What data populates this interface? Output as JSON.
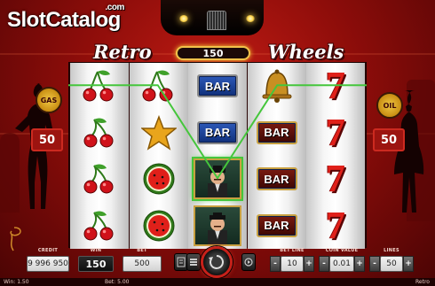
{
  "watermark": {
    "brand": "SlotCatalog",
    "suffix": ".com"
  },
  "game": {
    "title_left": "Retro",
    "title_right": "Wheels",
    "win_meter": "150",
    "side_left": {
      "badge": "GAS",
      "value": "50"
    },
    "side_right": {
      "badge": "OIL",
      "value": "50"
    }
  },
  "reels": [
    [
      "cherries",
      "cherry",
      "cherry",
      "cherry"
    ],
    [
      "cherries",
      "star",
      "watermelon",
      "watermelon"
    ],
    [
      "bar",
      "bar",
      "character",
      "character"
    ],
    [
      "bell",
      "bar-red",
      "bar-red",
      "bar-red"
    ],
    [
      "seven",
      "seven",
      "seven",
      "seven"
    ]
  ],
  "symbol_labels": {
    "bar": "BAR"
  },
  "winning_line": {
    "color": "#45c63c",
    "rows": [
      0,
      0,
      2,
      0,
      0
    ]
  },
  "panel": {
    "credit": {
      "label": "CREDIT",
      "value": "9 996 950"
    },
    "win": {
      "label": "WIN",
      "value": "150"
    },
    "bet": {
      "label": "BET",
      "value": "500"
    },
    "bet_line": {
      "label": "BET LINE",
      "value": "10"
    },
    "coin_value": {
      "label": "COIN VALUE",
      "value": "0.01"
    },
    "lines": {
      "label": "LINES",
      "value": "50"
    },
    "minus": "-",
    "plus": "+"
  },
  "status": {
    "win_text": "Win: 1.50",
    "bet_text": "Bet: 5.00",
    "game_name": "Retro"
  },
  "colors": {
    "background": "#8e0d0a",
    "accent_gold": "#f0c24a",
    "seven_red": "#e0201a",
    "bar_blue": "#1c3f92",
    "spin_ring": "#c7211a"
  }
}
